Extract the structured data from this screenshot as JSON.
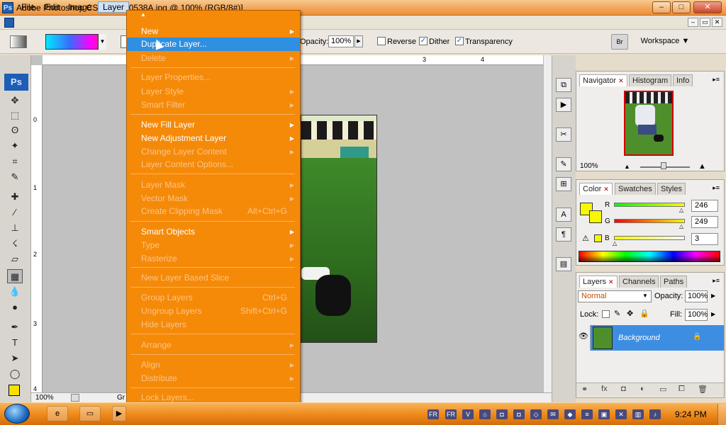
{
  "window": {
    "title": "Adobe Photoshop CS3 - [IMG0538A.jpg @ 100% (RGB/8#)]",
    "app_short": "Ps"
  },
  "menubar": [
    "File",
    "Edit",
    "Image",
    "Layer"
  ],
  "options_bar": {
    "opacity_label": "Opacity:",
    "opacity_value": "100%",
    "reverse_label": "Reverse",
    "dither_label": "Dither",
    "transparency_label": "Transparency",
    "reverse_checked": false,
    "dither_checked": true,
    "transparency_checked": true,
    "workspace_label": "Workspace ▼"
  },
  "layer_menu": {
    "items": [
      {
        "label": "New",
        "disabled": false,
        "submenu": true,
        "shortcut": ""
      },
      {
        "label": "Duplicate Layer...",
        "disabled": false,
        "submenu": false,
        "shortcut": "",
        "highlighted": true
      },
      {
        "label": "Delete",
        "disabled": true,
        "submenu": true,
        "shortcut": ""
      },
      {
        "label": "Layer Properties...",
        "disabled": true,
        "submenu": false,
        "shortcut": ""
      },
      {
        "label": "Layer Style",
        "disabled": true,
        "submenu": true,
        "shortcut": ""
      },
      {
        "label": "Smart Filter",
        "disabled": true,
        "submenu": true,
        "shortcut": ""
      },
      {
        "label": "New Fill Layer",
        "disabled": false,
        "submenu": true,
        "shortcut": ""
      },
      {
        "label": "New Adjustment Layer",
        "disabled": false,
        "submenu": true,
        "shortcut": ""
      },
      {
        "label": "Change Layer Content",
        "disabled": true,
        "submenu": true,
        "shortcut": ""
      },
      {
        "label": "Layer Content Options...",
        "disabled": true,
        "submenu": false,
        "shortcut": ""
      },
      {
        "label": "Layer Mask",
        "disabled": true,
        "submenu": true,
        "shortcut": ""
      },
      {
        "label": "Vector Mask",
        "disabled": true,
        "submenu": true,
        "shortcut": ""
      },
      {
        "label": "Create Clipping Mask",
        "disabled": true,
        "submenu": false,
        "shortcut": "Alt+Ctrl+G"
      },
      {
        "label": "Smart Objects",
        "disabled": false,
        "submenu": true,
        "shortcut": ""
      },
      {
        "label": "Type",
        "disabled": true,
        "submenu": true,
        "shortcut": ""
      },
      {
        "label": "Rasterize",
        "disabled": true,
        "submenu": true,
        "shortcut": ""
      },
      {
        "label": "New Layer Based Slice",
        "disabled": true,
        "submenu": false,
        "shortcut": ""
      },
      {
        "label": "Group Layers",
        "disabled": true,
        "submenu": false,
        "shortcut": "Ctrl+G"
      },
      {
        "label": "Ungroup Layers",
        "disabled": true,
        "submenu": false,
        "shortcut": "Shift+Ctrl+G"
      },
      {
        "label": "Hide Layers",
        "disabled": true,
        "submenu": false,
        "shortcut": ""
      },
      {
        "label": "Arrange",
        "disabled": true,
        "submenu": true,
        "shortcut": ""
      },
      {
        "label": "Align",
        "disabled": true,
        "submenu": true,
        "shortcut": ""
      },
      {
        "label": "Distribute",
        "disabled": true,
        "submenu": true,
        "shortcut": ""
      },
      {
        "label": "Lock Layers...",
        "disabled": true,
        "submenu": false,
        "shortcut": ""
      }
    ]
  },
  "document": {
    "zoom": "100%",
    "status_text": "Gr",
    "ruler_top_labels": [
      "3",
      "4"
    ],
    "ruler_left_labels": [
      "0",
      "1",
      "2",
      "3",
      "4"
    ]
  },
  "navigator_panel": {
    "tabs": [
      "Navigator",
      "Histogram",
      "Info"
    ],
    "zoom": "100%"
  },
  "color_panel": {
    "tabs": [
      "Color",
      "Swatches",
      "Styles"
    ],
    "channels": [
      {
        "label": "R",
        "value": "246"
      },
      {
        "label": "G",
        "value": "249"
      },
      {
        "label": "B",
        "value": "3"
      }
    ],
    "foreground_color": "#f6f903"
  },
  "layers_panel": {
    "tabs": [
      "Layers",
      "Channels",
      "Paths"
    ],
    "blend_mode": "Normal",
    "opacity_label": "Opacity:",
    "opacity_value": "100%",
    "lock_label": "Lock:",
    "fill_label": "Fill:",
    "fill_value": "100%",
    "layer_name": "Background"
  },
  "taskbar": {
    "clock": "9:24 PM"
  },
  "colors": {
    "menu_bg": "#f58a09",
    "menu_highlight": "#2f8fe0",
    "taskbar": "#ef8b1c"
  }
}
